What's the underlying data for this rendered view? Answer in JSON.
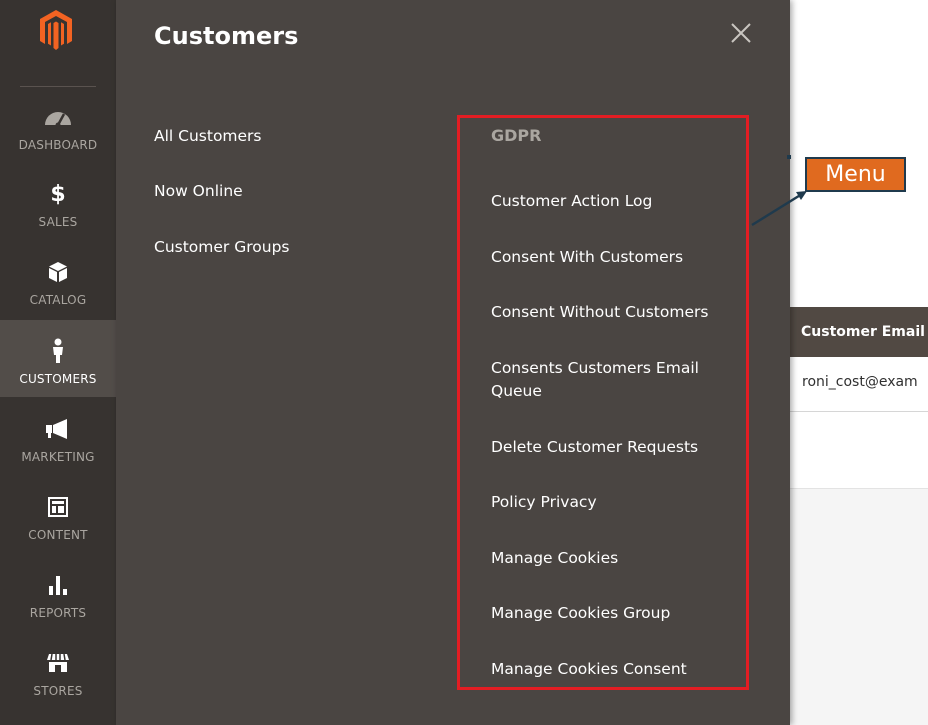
{
  "nav": {
    "items": [
      {
        "label": "DASHBOARD",
        "icon": "dashboard-icon"
      },
      {
        "label": "SALES",
        "icon": "dollar-icon"
      },
      {
        "label": "CATALOG",
        "icon": "cube-icon"
      },
      {
        "label": "CUSTOMERS",
        "icon": "customer-icon",
        "active": true
      },
      {
        "label": "MARKETING",
        "icon": "megaphone-icon"
      },
      {
        "label": "CONTENT",
        "icon": "layout-icon"
      },
      {
        "label": "REPORTS",
        "icon": "bar-chart-icon"
      },
      {
        "label": "STORES",
        "icon": "storefront-icon"
      }
    ],
    "sales_glyph": "$"
  },
  "panel": {
    "title": "Customers",
    "close_glyph": "×",
    "column1": [
      "All Customers",
      "Now Online",
      "Customer Groups"
    ],
    "gdpr": {
      "title": "GDPR",
      "items": [
        "Customer Action Log",
        "Consent With Customers",
        "Consent Without Customers",
        "Consents Customers Email Queue",
        "Delete Customer Requests",
        "Policy Privacy",
        "Manage Cookies",
        "Manage Cookies Group",
        "Manage Cookies Consent"
      ]
    }
  },
  "grid": {
    "header": "Customer Email",
    "row1_email": "roni_cost@exam"
  },
  "annotation": {
    "label": "Menu"
  },
  "colors": {
    "nav_bg": "#373330",
    "panel_bg": "#4a4542",
    "highlight_border": "#e31d23",
    "logo_orange": "#f26322",
    "callout_bg": "#e06a1f",
    "callout_border": "#1f3a4d"
  }
}
